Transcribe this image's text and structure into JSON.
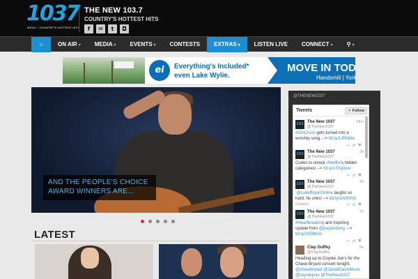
{
  "header": {
    "logo_number": "1037",
    "logo_tagline": "WSOC • COUNTRY'S HOTTEST HITS",
    "station_name": "THE NEW 103.7",
    "station_tagline": "COUNTRY'S HOTTEST HITS",
    "social": [
      {
        "icon": "facebook-icon",
        "glyph": "f"
      },
      {
        "icon": "email-icon",
        "glyph": "✉"
      },
      {
        "icon": "twitter-icon",
        "glyph": "t"
      },
      {
        "icon": "instagram-icon",
        "glyph": "◘"
      }
    ]
  },
  "nav": {
    "home_icon": "⌂",
    "items": [
      {
        "label": "ON AIR",
        "has_menu": true
      },
      {
        "label": "MEDIA",
        "has_menu": true
      },
      {
        "label": "EVENTS",
        "has_menu": true
      },
      {
        "label": "CONTESTS",
        "has_menu": false
      },
      {
        "label": "EXTRAS",
        "has_menu": true,
        "active": true
      },
      {
        "label": "LISTEN LIVE",
        "has_menu": false
      },
      {
        "label": "CONNECT",
        "has_menu": true
      }
    ],
    "search_glyph": "⚲"
  },
  "ad": {
    "logo_text": "ei",
    "line1": "Everything's Included*",
    "line2": "even Lake Wylie.",
    "cta": "MOVE IN TODAY.",
    "location": "Handsmill | York, SC"
  },
  "slider": {
    "caption_line1": "AND THE PEOPLE'S CHOICE",
    "caption_line2": "AWARD WINNERS ARE...",
    "dots": 5,
    "active_dot": 0
  },
  "latest": {
    "title": "LATEST"
  },
  "colors": {
    "accent": "#1b8fd2",
    "brand_blue": "#23a3dc",
    "active_dot": "#d53030"
  },
  "twitter": {
    "handle": "@THENEW1037",
    "title": "Tweets",
    "follow_label": "Follow",
    "tweets": [
      {
        "name": "The New 1037",
        "user": "@TheNew1037",
        "time": "58m",
        "lines": [
          "#GirlCrush gets turned into a",
          "worship song. --> bit.ly/1JPAjNa"
        ]
      },
      {
        "name": "The New 1037",
        "user": "@TheNew1037",
        "time": "2h",
        "lines": [
          "Codes to unlock #Netflix's hidden",
          "categories! --> bit.ly/1TKymox"
        ]
      },
      {
        "name": "The New 1037",
        "user": "@TheNew1037",
        "time": "3h",
        "lines": [
          ".@LukeBryanOnline laughs so",
          "hard, he cries! --> bit.ly/1mX0lYp"
        ],
        "expand": "Expand"
      },
      {
        "name": "The New 1037",
        "user": "@TheNew1037",
        "time": "7h",
        "lines": [
          "#Heartbreaking and inspiring",
          "update from @joeyandrory. -->",
          "bit.ly/1K56h2n"
        ]
      },
      {
        "name": "Clay Guffey",
        "user": "@ClayGuffey",
        "time": "9h",
        "lines": [
          "Heading up to Coyote Joe's for the",
          "Chase Bryant concert tonight.",
          "@chasebryant @JacobDavisMusic",
          "@coyotejoes @TheNew1037"
        ]
      }
    ]
  }
}
